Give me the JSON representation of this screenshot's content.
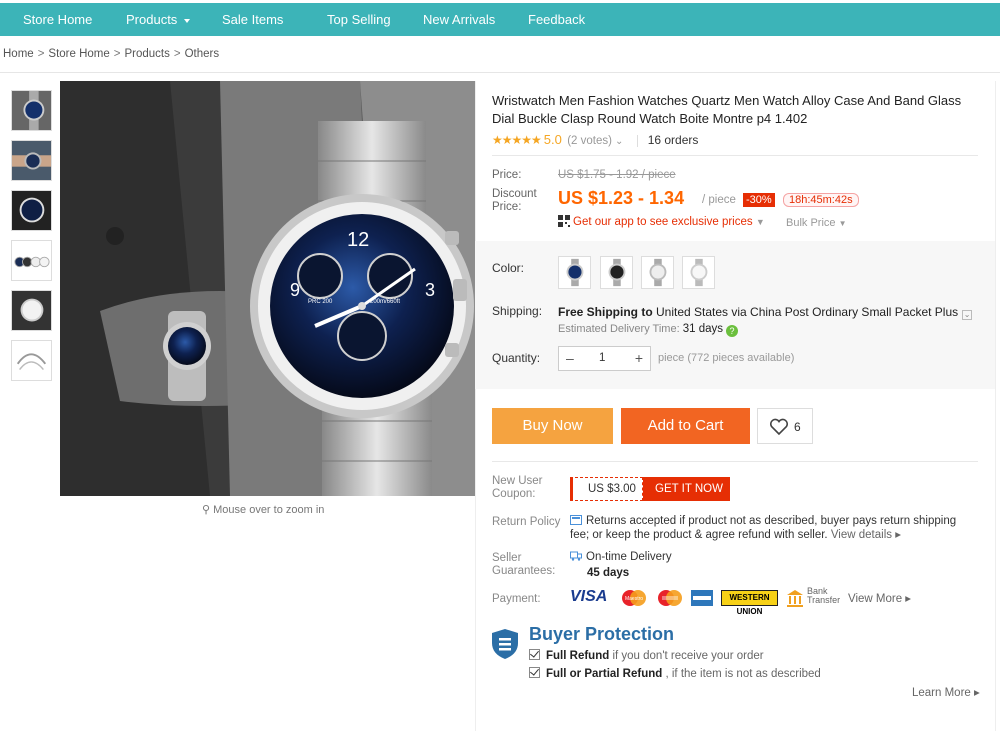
{
  "nav": {
    "items": [
      {
        "label": "Store Home"
      },
      {
        "label": "Products"
      },
      {
        "label": "Sale Items"
      },
      {
        "label": "Top Selling"
      },
      {
        "label": "New Arrivals"
      },
      {
        "label": "Feedback"
      }
    ]
  },
  "breadcrumb": [
    "Home",
    "Store Home",
    "Products",
    "Others"
  ],
  "gallery": {
    "zoom_hint": "Mouse over to zoom in",
    "dial_marks": {
      "twelve": "12",
      "nine": "9",
      "three": "3",
      "sub_left": "PRC 200",
      "sub_right": "200m/660ft"
    }
  },
  "product": {
    "title": "Wristwatch Men Fashion Watches Quartz Men Watch Alloy Case And Band Glass Dial Buckle Clasp Round Watch Boite Montre p4 1.402",
    "stars": "★★★★★",
    "rating": "5.0",
    "votes": "(2 votes)",
    "orders": "16 orders"
  },
  "price": {
    "label": "Price:",
    "original": "US $1.75 - 1.92 / piece",
    "discount_label": "Discount\nPrice:",
    "discount": "US $1.23 - 1.34",
    "unit": "/ piece",
    "off": "-30%",
    "timer": "18h:45m:42s",
    "app_link": "Get our app to see exclusive prices",
    "bulk": "Bulk Price"
  },
  "options": {
    "color_label": "Color:",
    "shipping_label": "Shipping:",
    "shipping_free": "Free Shipping to",
    "shipping_rest": " United States via China Post Ordinary Small Packet Plus",
    "eta_label": "Estimated Delivery Time:",
    "eta_value": "31 days",
    "quantity_label": "Quantity:",
    "quantity": "1",
    "quantity_avail": "piece (772 pieces available)"
  },
  "actions": {
    "buy_now": "Buy Now",
    "add_to_cart": "Add to Cart",
    "wishlist_count": "6"
  },
  "coupon": {
    "label": "New User\nCoupon:",
    "amount": "US $3.00",
    "get": "GET IT NOW"
  },
  "policy": {
    "return_label": "Return Policy",
    "return_text": "Returns accepted if product not as described, buyer pays return shipping fee; or keep the product & agree refund with seller.",
    "view_details": "View details ▸",
    "guarantee_label": "Seller\nGuarantees:",
    "guarantee_text": "On-time Delivery",
    "guarantee_days": "45 days",
    "payment_label": "Payment:",
    "payment_methods": {
      "visa": "VISA",
      "maestro": "Maestro",
      "wu": "WESTERN UNION",
      "bank": "Bank\nTransfer"
    },
    "view_more": "View More ▸"
  },
  "protection": {
    "title": "Buyer Protection",
    "line1_bold": "Full Refund",
    "line1_rest": " if you don't receive your order",
    "line2_bold": "Full or Partial Refund",
    "line2_rest": " , if the item is not as described",
    "learn_more": "Learn More ▸"
  },
  "colors": {
    "nav_bg": "#3cb4b8",
    "price_orange": "#ff6600",
    "buy_now": "#f5a340",
    "add_to_cart": "#f26522",
    "alert_red": "#e62e04",
    "protection_blue": "#2b6ea6"
  }
}
